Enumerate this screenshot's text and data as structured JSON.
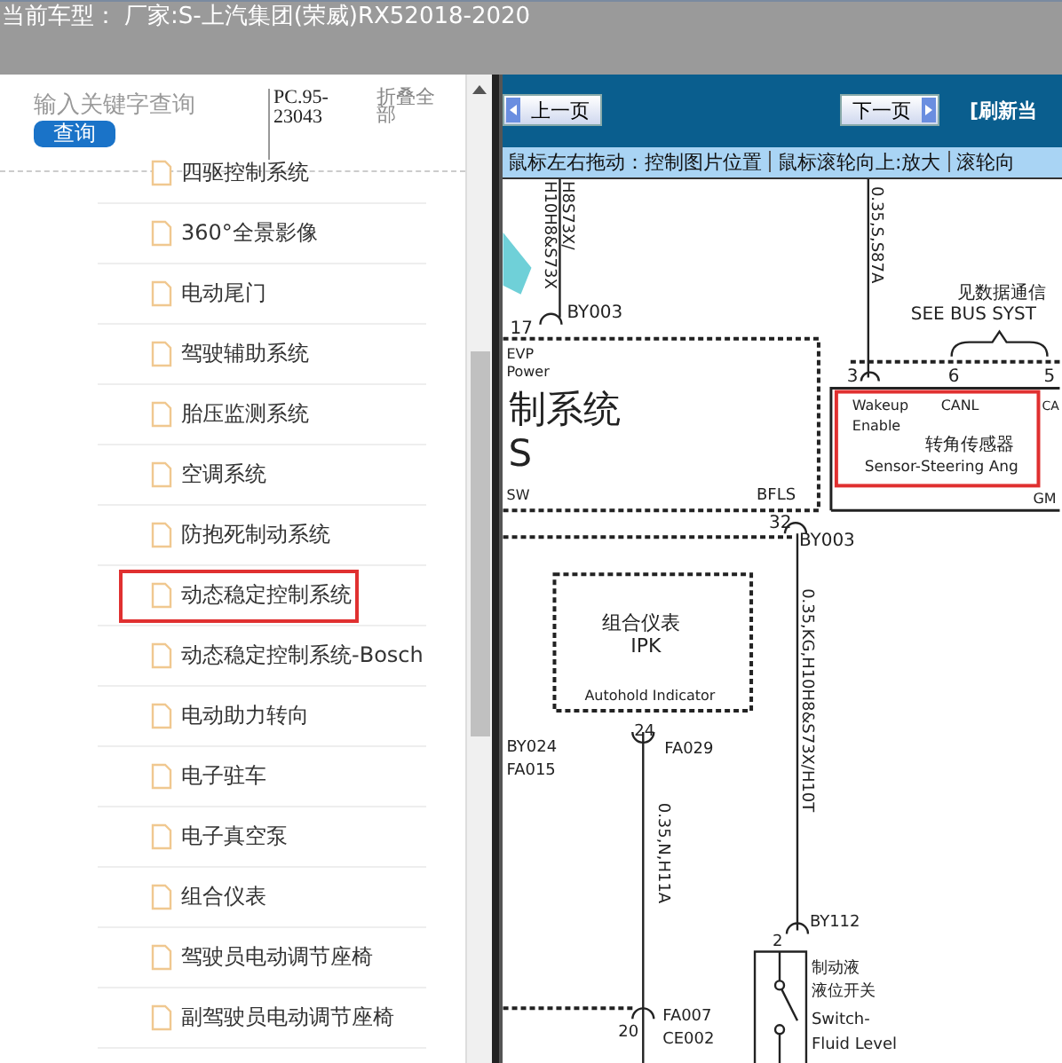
{
  "title_bar": {
    "label": "当前车型：",
    "value": "厂家:S-上汽集团(荣威)RX52018-2020"
  },
  "sidebar": {
    "search": {
      "placeholder": "输入关键字查询"
    },
    "search_button": "查询",
    "code": "PC.95-23043",
    "collapse_all": "折叠全部",
    "items": [
      {
        "label": "四驱控制系统",
        "highlighted": false
      },
      {
        "label": "360°全景影像",
        "highlighted": false
      },
      {
        "label": "电动尾门",
        "highlighted": false
      },
      {
        "label": "驾驶辅助系统",
        "highlighted": false
      },
      {
        "label": "胎压监测系统",
        "highlighted": false
      },
      {
        "label": "空调系统",
        "highlighted": false
      },
      {
        "label": "防抱死制动系统",
        "highlighted": false
      },
      {
        "label": "动态稳定控制系统",
        "highlighted": true
      },
      {
        "label": "动态稳定控制系统-Bosch",
        "highlighted": false
      },
      {
        "label": "电动助力转向",
        "highlighted": false
      },
      {
        "label": "电子驻车",
        "highlighted": false
      },
      {
        "label": "电子真空泵",
        "highlighted": false
      },
      {
        "label": "组合仪表",
        "highlighted": false
      },
      {
        "label": "驾驶员电动调节座椅",
        "highlighted": false
      },
      {
        "label": "副驾驶员电动调节座椅",
        "highlighted": false
      }
    ]
  },
  "viewer": {
    "prev_button": "上一页",
    "next_button": "下一页",
    "refresh": "[刷新当",
    "hints": [
      "鼠标左右拖动：控制图片位置",
      "鼠标滚轮向上:放大",
      "滚轮向"
    ],
    "diagram_labels": [
      "H8S73X/",
      "H10H8&S73X",
      "0.35,S,S87A",
      "BY003",
      "17",
      "EVP",
      "Power",
      "制系统",
      "S",
      "SW",
      "BFLS",
      "32",
      "BY003",
      "见数据通信",
      "SEE BUS SYST",
      "3",
      "6",
      "5",
      "Wakeup",
      "Enable",
      "CANL",
      "CA",
      "转角传感器",
      "Sensor-Steering Ang",
      "GM",
      "组合仪表",
      "IPK",
      "Autohold Indicator",
      "24",
      "FA029",
      "BY024",
      "FA015",
      "0.35,KG,H10H8&S73X/H10T",
      "0.35,N,H11A",
      "BY112",
      "2",
      "制动液",
      "液位开关",
      "Switch-",
      "Fluid Level",
      "20",
      "FA007",
      "CE002"
    ]
  }
}
